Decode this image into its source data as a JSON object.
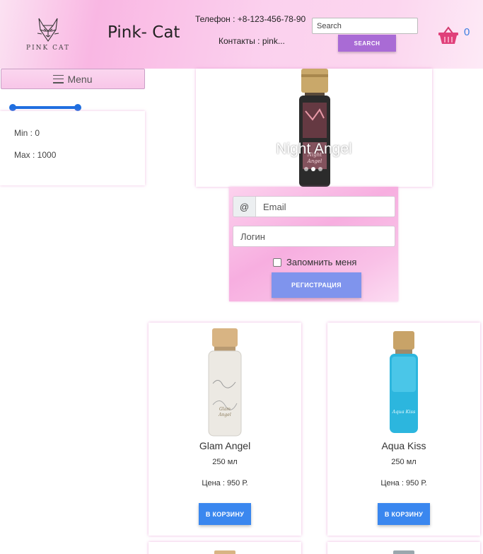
{
  "header": {
    "logo_text": "PINK CAT",
    "brand": "Pink- Cat",
    "phone": "Телефон : +8-123-456-78-90",
    "contacts": "Контакты : pink...",
    "search_placeholder": "Search",
    "search_button": "SEARCH",
    "cart_count": "0",
    "icons": {
      "logo": "cat-logo-icon",
      "cart": "basket-icon"
    }
  },
  "sidebar": {
    "menu_label": "Menu",
    "price_range": {
      "min_fraction": 0,
      "max_fraction": 1
    },
    "min_label": "Min : 0",
    "max_label": "Max : 1000"
  },
  "hero": {
    "caption": "Night Angel",
    "slides": 3,
    "active_slide": 1
  },
  "registration": {
    "email_prefix": "@",
    "email_placeholder": "Email",
    "login_placeholder": "Логин",
    "remember_label": "Запомнить меня",
    "remember_checked": false,
    "submit_label": "РЕГИСТРАЦИЯ"
  },
  "products": [
    {
      "name": "Glam Angel",
      "volume": "250 мл",
      "price": "Цена : 950 Р.",
      "buy_label": "В КОРЗИНУ",
      "bottle_color": "#e8e4dc",
      "cap_color": "#c9a36a"
    },
    {
      "name": "Aqua Kiss",
      "volume": "250 мл",
      "price": "Цена : 950 Р.",
      "buy_label": "В КОРЗИНУ",
      "bottle_color": "#2bb5dd",
      "cap_color": "#c5a060"
    }
  ],
  "colors": {
    "header_pink": "#f9b7e3",
    "search_button": "#a96bd5",
    "register_button": "#7f94ed",
    "buy_button": "#3a87ef",
    "slider": "#1f6fe0",
    "cart": "#e0407a"
  }
}
